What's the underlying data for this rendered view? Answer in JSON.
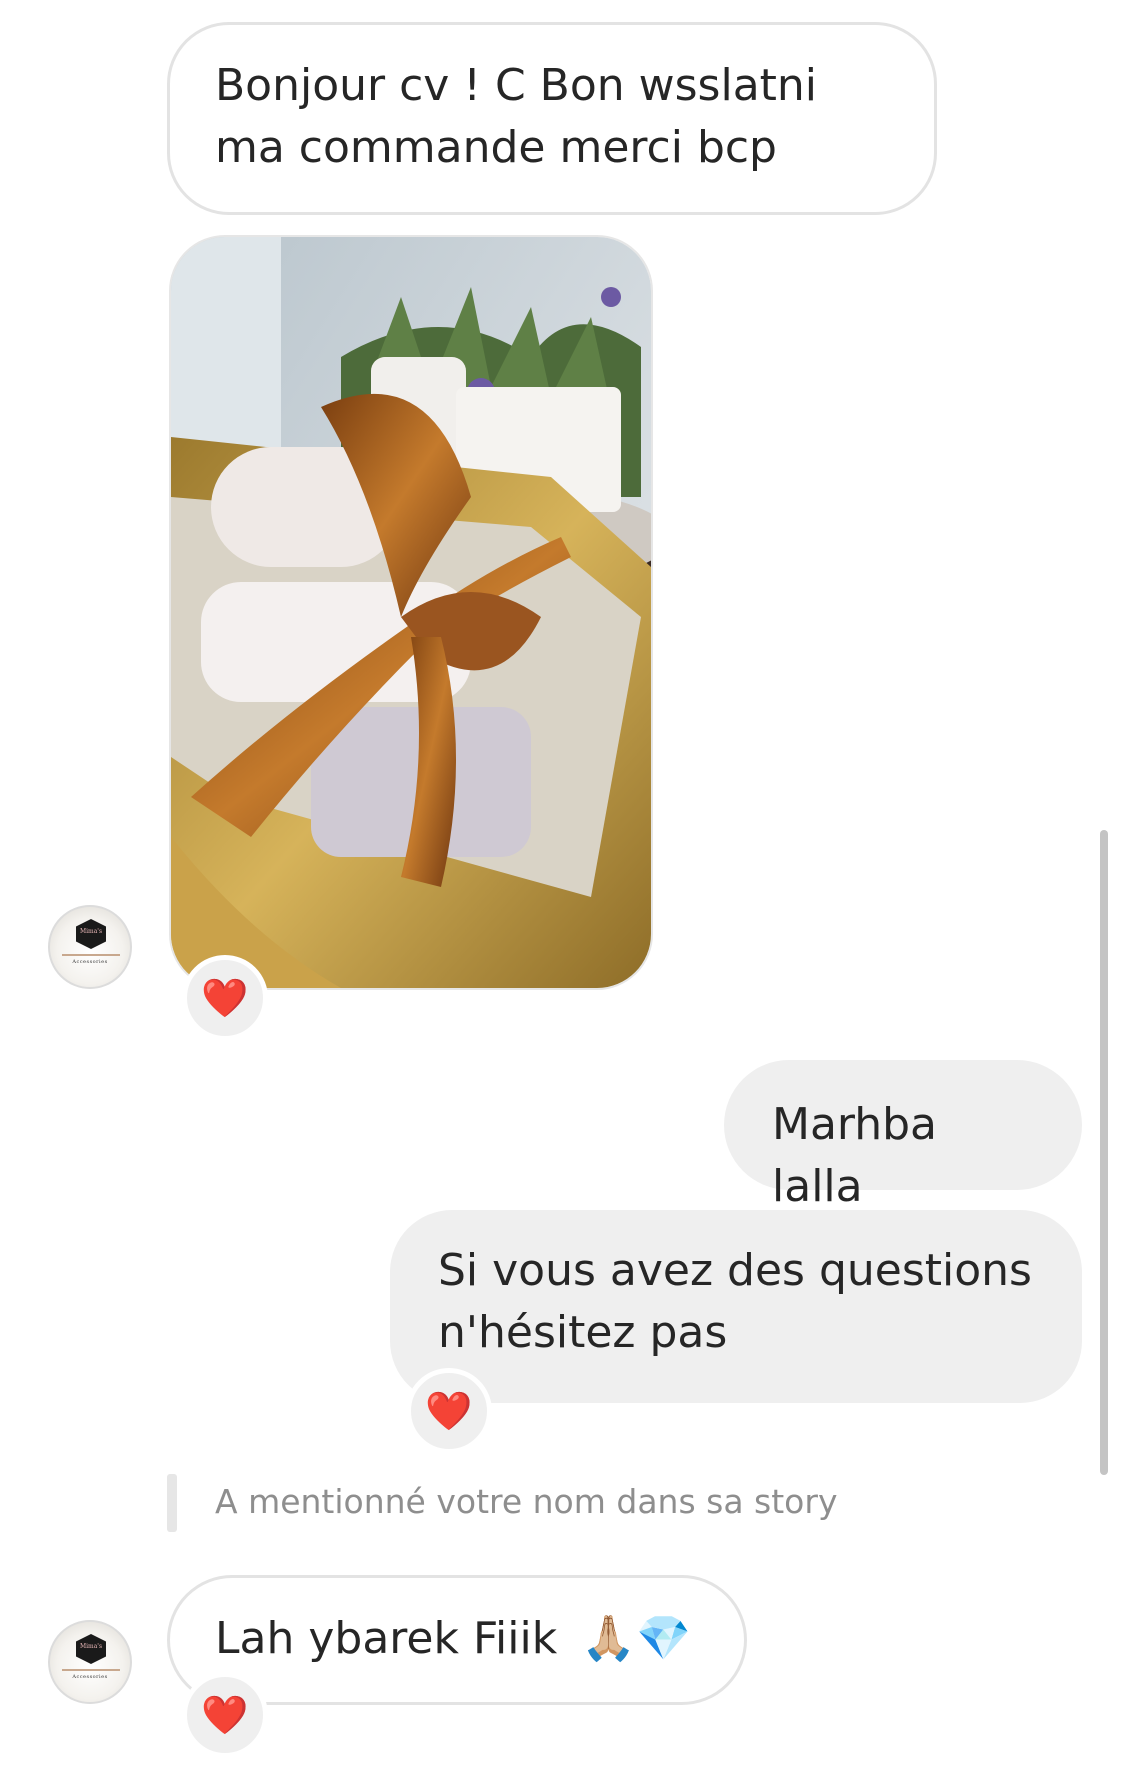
{
  "messages": {
    "m1": {
      "text": "Bonjour cv ! C Bon wsslatni ma commande merci bcp"
    },
    "m2": {
      "text": "Marhba lalla"
    },
    "m3": {
      "text": "Si vous avez des questions n'hésitez pas"
    },
    "m4": {
      "text": "Lah ybarek Fiiik",
      "emojis": "🙏🏼💎"
    }
  },
  "reactions": {
    "photo": "❤️",
    "m3": "❤️",
    "m4": "❤️"
  },
  "story_mention": "A mentionné votre nom dans sa story",
  "avatar": {
    "brand": "Mima's",
    "sub": "Accessories"
  },
  "colors": {
    "incoming_border": "#e3e3e3",
    "outgoing_bg": "#efefef",
    "text": "#262626",
    "meta_text": "#8e8e8e",
    "ribbon": "#a9621f",
    "gift_box": "#c9a44e"
  },
  "icons": {
    "reaction": "red-heart-icon",
    "avatar": "shop-logo-avatar"
  }
}
